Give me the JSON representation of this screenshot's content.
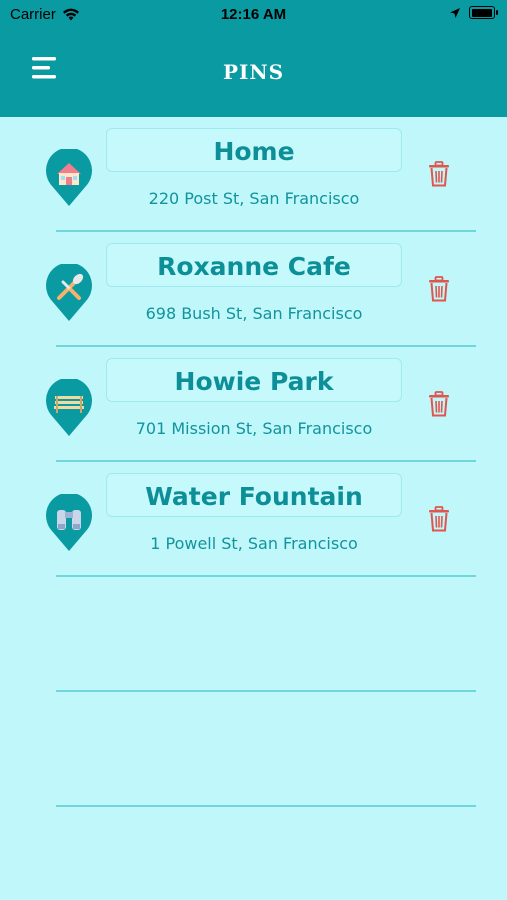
{
  "status": {
    "carrier": "Carrier",
    "time": "12:16 AM"
  },
  "header": {
    "title": "PINS",
    "menu_icon": "menu-icon"
  },
  "colors": {
    "header": "#0a9aa2",
    "background": "#bff7fb",
    "accent": "#0c8f97",
    "delete": "#e0564d"
  },
  "pins": [
    {
      "name": "Home",
      "address": "220 Post St, San Francisco",
      "icon": "house-icon"
    },
    {
      "name": "Roxanne Cafe",
      "address": "698 Bush St, San Francisco",
      "icon": "utensils-icon"
    },
    {
      "name": "Howie Park",
      "address": "701 Mission St, San Francisco",
      "icon": "bench-icon"
    },
    {
      "name": "Water Fountain",
      "address": "1 Powell St, San Francisco",
      "icon": "fountain-icon"
    }
  ]
}
